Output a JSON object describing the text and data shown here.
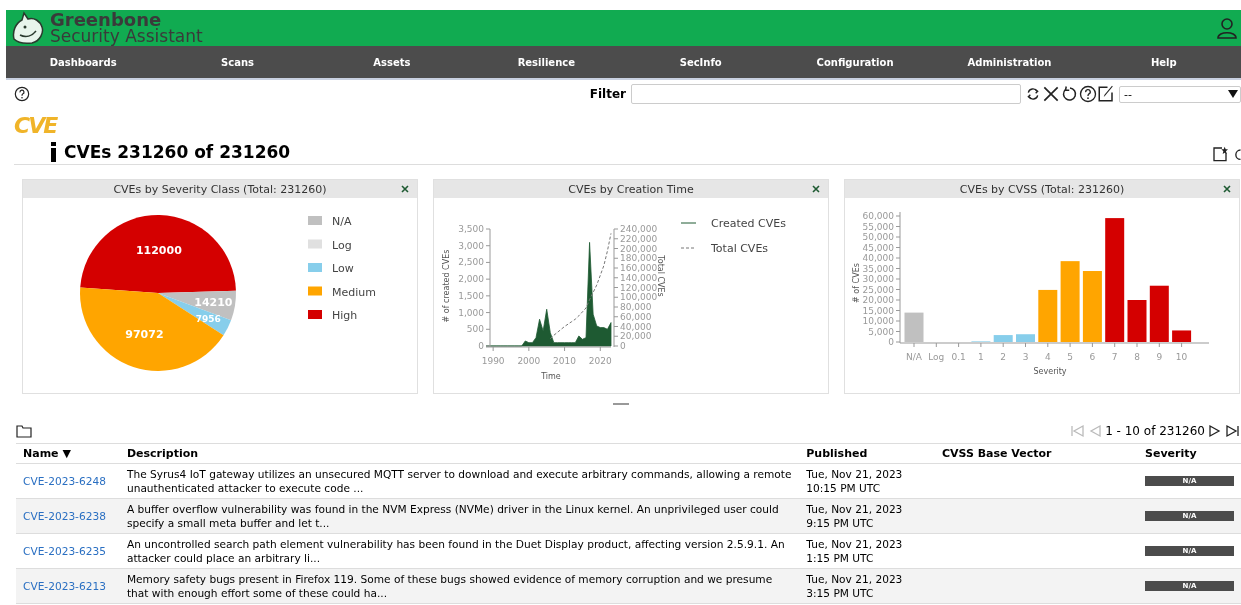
{
  "header": {
    "brand": "Greenbone",
    "product": "Security Assistant"
  },
  "nav": [
    "Dashboards",
    "Scans",
    "Assets",
    "Resilience",
    "SecInfo",
    "Configuration",
    "Administration",
    "Help"
  ],
  "filter": {
    "label": "Filter",
    "select_value": "--"
  },
  "page": {
    "logo": "CVE",
    "title": "CVEs 231260 of 231260"
  },
  "charts": [
    {
      "title": "CVEs by Severity Class (Total: 231260)",
      "chart_data": {
        "type": "pie",
        "categories": [
          "N/A",
          "Log",
          "Low",
          "Medium",
          "High"
        ],
        "values": [
          14210,
          null,
          7956,
          97072,
          112000
        ],
        "colors": [
          "#c0c0c0",
          "#e0e0e0",
          "#87ceeb",
          "#ffa500",
          "#d40000"
        ],
        "value_labels": [
          "14210",
          null,
          "7956",
          "97072",
          "112000"
        ],
        "legend": "right"
      }
    },
    {
      "title": "CVEs by Creation Time",
      "chart_data": {
        "type": "line",
        "xlabel": "Time",
        "ylabel": "# of created CVEs",
        "y2label": "Total CVEs",
        "xlim": [
          1988,
          2023
        ],
        "ylim": [
          0,
          3500
        ],
        "y2lim": [
          0,
          240000
        ],
        "legend": "right",
        "x": [
          1988,
          1989,
          1990,
          1991,
          1992,
          1993,
          1994,
          1995,
          1996,
          1997,
          1998,
          1999,
          2000,
          2001,
          2002,
          2003,
          2004,
          2005,
          2006,
          2007,
          2008,
          2009,
          2010,
          2011,
          2012,
          2013,
          2014,
          2015,
          2016,
          2017,
          2018,
          2019,
          2020,
          2021,
          2022,
          2023
        ],
        "series": [
          {
            "name": "Created CVEs",
            "type": "area",
            "color": "#1e5a32",
            "values": [
              0,
              0,
              0,
              0,
              0,
              0,
              0,
              0,
              0,
              0,
              0,
              150,
              100,
              100,
              250,
              800,
              450,
              1100,
              400,
              100,
              100,
              100,
              100,
              100,
              100,
              100,
              300,
              200,
              250,
              3100,
              950,
              600,
              550,
              550,
              500,
              700
            ]
          },
          {
            "name": "Total CVEs",
            "type": "line",
            "axis": "y2",
            "line_style": "dashed",
            "color": "#777777",
            "values": [
              null,
              null,
              null,
              null,
              null,
              null,
              null,
              null,
              null,
              null,
              null,
              null,
              null,
              null,
              null,
              null,
              null,
              null,
              15000,
              22000,
              28000,
              34000,
              40000,
              45000,
              50000,
              55000,
              62000,
              70000,
              78000,
              95000,
              110000,
              125000,
              145000,
              165000,
              195000,
              231000
            ]
          }
        ],
        "xticks": [
          1990,
          2000,
          2010,
          2020
        ],
        "yticks": [
          0,
          {
            "value": 500,
            "label": "500"
          },
          {
            "value": 1000,
            "label": "1,000"
          },
          {
            "value": 1500,
            "label": "1,500"
          },
          {
            "value": 2000,
            "label": "2,000"
          },
          {
            "value": 2500,
            "label": "2,500"
          },
          {
            "value": 3000,
            "label": "3,000"
          },
          {
            "value": 3500,
            "label": "3,500"
          }
        ],
        "y2ticks": [
          0,
          {
            "value": 20000,
            "label": "20,000"
          },
          {
            "value": 40000,
            "label": "40,000"
          },
          {
            "value": 60000,
            "label": "60,000"
          },
          {
            "value": 80000,
            "label": "80,000"
          },
          {
            "value": 100000,
            "label": "100,000"
          },
          {
            "value": 120000,
            "label": "120,000"
          },
          {
            "value": 140000,
            "label": "140,000"
          },
          {
            "value": 160000,
            "label": "160,000"
          },
          {
            "value": 180000,
            "label": "180,000"
          },
          {
            "value": 200000,
            "label": "200,000"
          },
          {
            "value": 220000,
            "label": "220,000"
          },
          {
            "value": 240000,
            "label": "240,000"
          }
        ]
      }
    },
    {
      "title": "CVEs by CVSS (Total: 231260)",
      "chart_data": {
        "type": "bar",
        "xlabel": "Severity",
        "ylabel": "# of CVEs",
        "categories": [
          "N/A",
          "Log",
          "0.1",
          "1",
          "2",
          "3",
          "4",
          "5",
          "6",
          "7",
          "8",
          "9",
          "10"
        ],
        "ylim": [
          0,
          60000
        ],
        "series": [
          {
            "color": "#c0c0c0",
            "values": [
              14000,
              null,
              null,
              null,
              null,
              null,
              null,
              null,
              null,
              null,
              null,
              null,
              null
            ]
          },
          {
            "color": "#87ceeb",
            "values": [
              null,
              0,
              0,
              300,
              3300,
              3700,
              null,
              null,
              null,
              null,
              null,
              null,
              null
            ]
          },
          {
            "color": "#ffa500",
            "values": [
              null,
              null,
              null,
              null,
              null,
              null,
              24800,
              38500,
              33800,
              null,
              null,
              null,
              null
            ]
          },
          {
            "color": "#d40000",
            "values": [
              null,
              null,
              null,
              null,
              null,
              null,
              null,
              null,
              null,
              59000,
              20000,
              26800,
              5500
            ]
          }
        ],
        "yticks": [
          0,
          {
            "value": 5000,
            "label": "5,000"
          },
          {
            "value": 10000,
            "label": "10,000"
          },
          {
            "value": 15000,
            "label": "15,000"
          },
          {
            "value": 20000,
            "label": "20,000"
          },
          {
            "value": 25000,
            "label": "25,000"
          },
          {
            "value": 30000,
            "label": "30,000"
          },
          {
            "value": 35000,
            "label": "35,000"
          },
          {
            "value": 40000,
            "label": "40,000"
          },
          {
            "value": 45000,
            "label": "45,000"
          },
          {
            "value": 50000,
            "label": "50,000"
          },
          {
            "value": 55000,
            "label": "55,000"
          },
          {
            "value": 60000,
            "label": "60,000"
          }
        ]
      }
    }
  ],
  "pagination": {
    "text": "1 - 10 of 231260",
    "buttons": [
      {
        "kind": "first",
        "disabled": true
      },
      {
        "kind": "previous",
        "disabled": true
      },
      {
        "kind": "next",
        "disabled": false
      },
      {
        "kind": "last",
        "disabled": false
      }
    ]
  },
  "table": {
    "columns": [
      "Name ▼",
      "Description",
      "Published",
      "CVSS Base Vector",
      "Severity"
    ],
    "rows": [
      {
        "name": "CVE-2023-6248",
        "description": "The Syrus4 IoT gateway utilizes an unsecured MQTT server to download and execute arbitrary commands, allowing a remote unauthenticated attacker to execute code ...",
        "published": "Tue, Nov 21, 2023 10:15 PM UTC",
        "severity": "N/A"
      },
      {
        "name": "CVE-2023-6238",
        "description": "A buffer overflow vulnerability was found in the NVM Express (NVMe) driver in the Linux kernel. An unprivileged user could specify a small meta buffer and let t...",
        "published": "Tue, Nov 21, 2023 9:15 PM UTC",
        "severity": "N/A"
      },
      {
        "name": "CVE-2023-6235",
        "description": "An uncontrolled search path element vulnerability has been found in the Duet Display product, affecting version 2.5.9.1. An attacker could place an arbitrary li...",
        "published": "Tue, Nov 21, 2023 1:15 PM UTC",
        "severity": "N/A"
      },
      {
        "name": "CVE-2023-6213",
        "description": "Memory safety bugs present in Firefox 119. Some of these bugs showed evidence of memory corruption and we presume that with enough effort some of these could ha...",
        "published": "Tue, Nov 21, 2023 3:15 PM UTC",
        "severity": "N/A"
      }
    ]
  }
}
